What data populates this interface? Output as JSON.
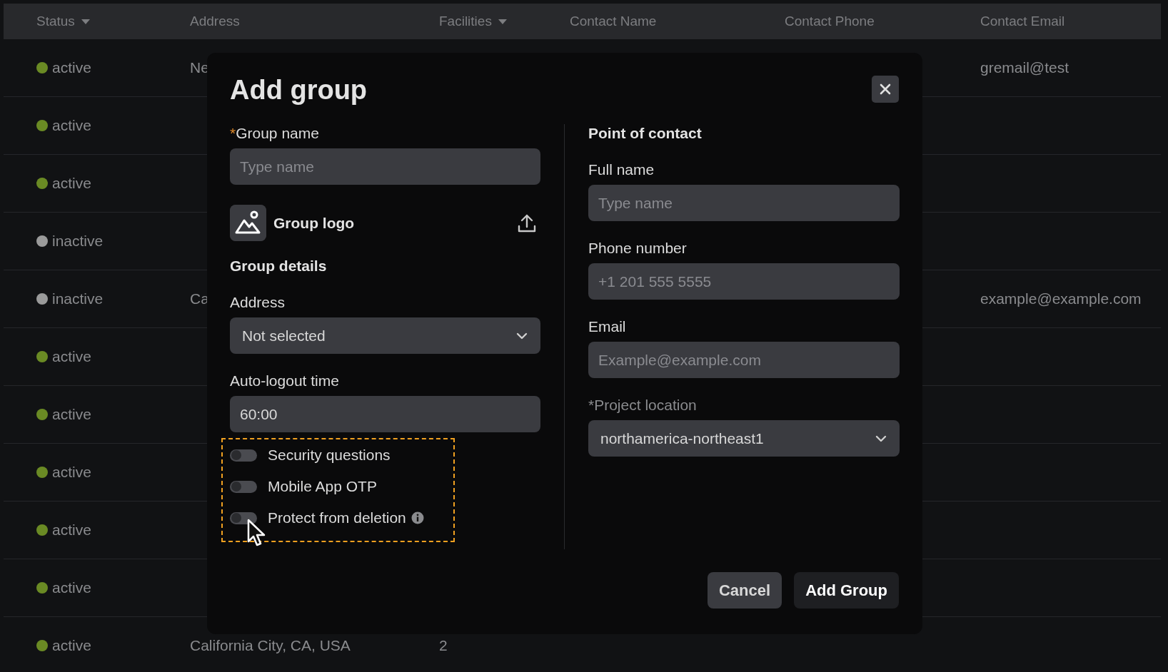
{
  "table": {
    "columns": [
      {
        "label": "Status",
        "dropdown": true
      },
      {
        "label": "Address",
        "dropdown": false
      },
      {
        "label": "Facilities",
        "dropdown": true
      },
      {
        "label": "Contact Name",
        "dropdown": false
      },
      {
        "label": "Contact Phone",
        "dropdown": false
      },
      {
        "label": "Contact Email",
        "dropdown": false
      }
    ],
    "rows": [
      {
        "status": "active",
        "color": "#6a8a24",
        "address": "Ne",
        "email": "gremail@test"
      },
      {
        "status": "active",
        "color": "#6a8a24"
      },
      {
        "status": "active",
        "color": "#6a8a24"
      },
      {
        "status": "inactive",
        "color": "#9a9a9a"
      },
      {
        "status": "inactive",
        "color": "#9a9a9a",
        "address": "Ca",
        "email": "example@example.com"
      },
      {
        "status": "active",
        "color": "#6a8a24"
      },
      {
        "status": "active",
        "color": "#6a8a24"
      },
      {
        "status": "active",
        "color": "#6a8a24"
      },
      {
        "status": "active",
        "color": "#6a8a24"
      },
      {
        "status": "active",
        "color": "#6a8a24"
      },
      {
        "status": "active",
        "color": "#6a8a24",
        "address": "California City, CA, USA",
        "facilities": "2"
      }
    ]
  },
  "dialog": {
    "title": "Add group",
    "group_name": {
      "required_mark": "*",
      "label": "Group name",
      "placeholder": "Type name"
    },
    "group_logo": {
      "label": "Group logo"
    },
    "group_details": {
      "heading": "Group details"
    },
    "address": {
      "label": "Address",
      "value": "Not selected"
    },
    "auto_logout": {
      "label": "Auto-logout time",
      "value": "60:00"
    },
    "toggles": [
      {
        "label": "Security questions",
        "checked": false,
        "info": false
      },
      {
        "label": "Mobile App OTP",
        "checked": false,
        "info": false
      },
      {
        "label": "Protect from deletion",
        "checked": false,
        "info": true
      }
    ],
    "point_of_contact": {
      "heading": "Point of contact",
      "full_name": {
        "label": "Full name",
        "placeholder": "Type name"
      },
      "phone": {
        "label": "Phone number",
        "placeholder": "+1 201 555 5555"
      },
      "email": {
        "label": "Email",
        "placeholder": "Example@example.com"
      },
      "project_location": {
        "required_mark": "*",
        "label": "Project location",
        "value": "northamerica-northeast1"
      }
    },
    "buttons": [
      {
        "label": "Cancel",
        "kind": "secondary"
      },
      {
        "label": "Add Group",
        "kind": "primary"
      }
    ]
  }
}
